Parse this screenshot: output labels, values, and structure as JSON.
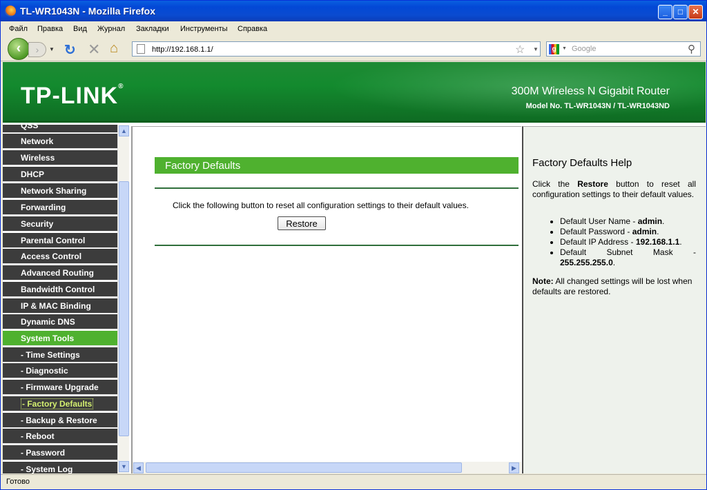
{
  "window": {
    "title": "TL-WR1043N - Mozilla Firefox"
  },
  "menubar": [
    "Файл",
    "Правка",
    "Вид",
    "Журнал",
    "Закладки",
    "Инструменты",
    "Справка"
  ],
  "navbar": {
    "url": "http://192.168.1.1/",
    "search_placeholder": "Google"
  },
  "banner": {
    "logo": "TP-LINK",
    "product": "300M Wireless N Gigabit Router",
    "model": "Model No. TL-WR1043N / TL-WR1043ND"
  },
  "sidebar": {
    "items": [
      {
        "label": "QSS"
      },
      {
        "label": "Network"
      },
      {
        "label": "Wireless"
      },
      {
        "label": "DHCP"
      },
      {
        "label": "Network Sharing"
      },
      {
        "label": "Forwarding"
      },
      {
        "label": "Security"
      },
      {
        "label": "Parental Control"
      },
      {
        "label": "Access Control"
      },
      {
        "label": "Advanced Routing"
      },
      {
        "label": "Bandwidth Control"
      },
      {
        "label": "IP & MAC Binding"
      },
      {
        "label": "Dynamic DNS"
      },
      {
        "label": "System Tools"
      },
      {
        "label": "- Time Settings"
      },
      {
        "label": "- Diagnostic"
      },
      {
        "label": "- Firmware Upgrade"
      },
      {
        "label": "- Factory Defaults"
      },
      {
        "label": "- Backup & Restore"
      },
      {
        "label": "- Reboot"
      },
      {
        "label": "- Password"
      },
      {
        "label": "- System Log"
      }
    ]
  },
  "main": {
    "title": "Factory Defaults",
    "text": "Click the following button to reset all configuration settings to their default values.",
    "restore_label": "Restore"
  },
  "help": {
    "title": "Factory Defaults Help",
    "intro_pre": "Click the ",
    "intro_bold": "Restore",
    "intro_post": " button to reset all configuration settings to their default values.",
    "items": [
      {
        "label": "Default User Name - ",
        "value": "admin",
        "end": "."
      },
      {
        "label": "Default Password - ",
        "value": "admin",
        "end": "."
      },
      {
        "label": "Default IP Address - ",
        "value": "192.168.1.1",
        "end": "."
      },
      {
        "label": "Default Subnet Mask - ",
        "value": "255.255.255.0",
        "end": "."
      }
    ],
    "note_label": "Note:",
    "note_text": " All changed settings will be lost when defaults are restored."
  },
  "statusbar": {
    "text": "Готово"
  }
}
